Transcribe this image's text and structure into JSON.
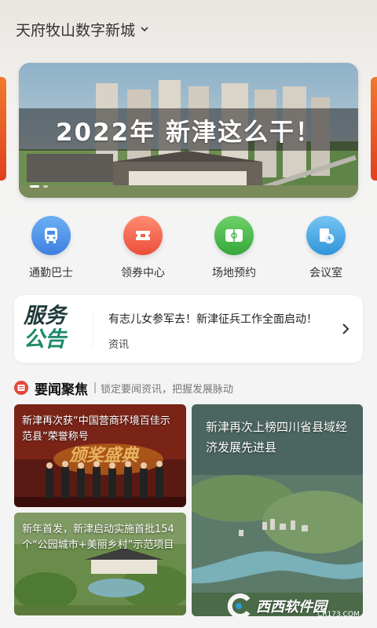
{
  "header": {
    "title": "天府牧山数字新城"
  },
  "banner": {
    "caption": "2022年 新津这么干！"
  },
  "quick_entries": [
    {
      "label": "通勤巴士",
      "icon": "bus-icon",
      "color": "#4a8fe7"
    },
    {
      "label": "领券中心",
      "icon": "coupon-icon",
      "color": "#f0604a"
    },
    {
      "label": "场地预约",
      "icon": "field-icon",
      "color": "#45b84a"
    },
    {
      "label": "会议室",
      "icon": "meeting-room-icon",
      "color": "#3fa7e6"
    }
  ],
  "notice": {
    "logo_line1": "服务",
    "logo_line2": "公告",
    "text": "有志儿女参军去！新津征兵工作全面启动！",
    "tag": "资讯"
  },
  "section": {
    "title": "要闻聚焦",
    "subtitle": "锁定要闻资讯，把握发展脉动"
  },
  "news": [
    {
      "title": "新津再次获“中国营商环境百佳示范县”荣誉称号",
      "image_text": "颁奖盛典"
    },
    {
      "title": "新年首发，新津启动实施首批154个“公园城市+美丽乡村”示范项目"
    },
    {
      "title": "新津再次上榜四川省县域经济发展先进县"
    }
  ],
  "watermark": {
    "brand": "西西软件园",
    "url": "CR173.COM"
  }
}
